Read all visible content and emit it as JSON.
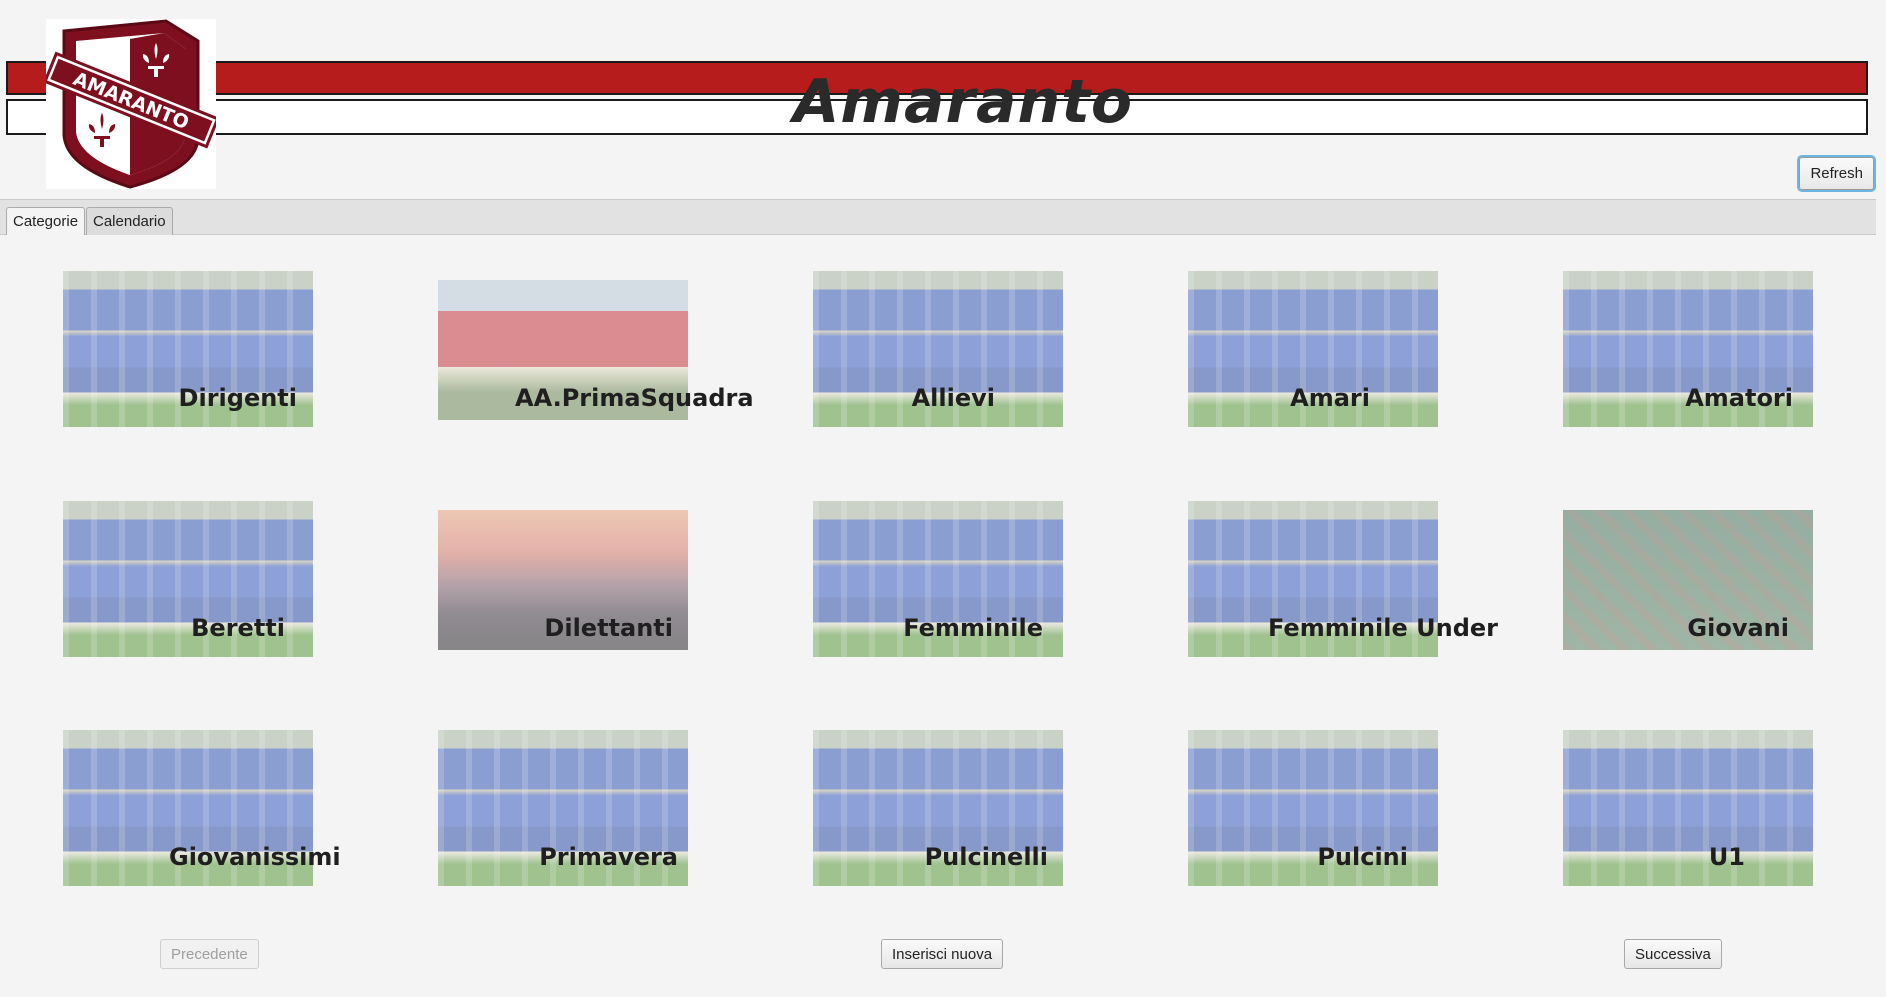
{
  "header": {
    "title": "Amaranto",
    "logo_text": "AMARANTO",
    "brand_color": "#b71c1c"
  },
  "toolbar": {
    "refresh_label": "Refresh"
  },
  "tabs": [
    {
      "label": "Categorie",
      "active": true
    },
    {
      "label": "Calendario",
      "active": false
    }
  ],
  "categories": [
    {
      "label": "Dirigenti",
      "image": "team-photo"
    },
    {
      "label": "AA.PrimaSquadra",
      "image": "red-team-photo"
    },
    {
      "label": "Allievi",
      "image": "team-photo"
    },
    {
      "label": "Amari",
      "image": "team-photo"
    },
    {
      "label": "Amatori",
      "image": "team-photo"
    },
    {
      "label": "Beretti",
      "image": "team-photo"
    },
    {
      "label": "Dilettanti",
      "image": "canal-photo"
    },
    {
      "label": "Femminile",
      "image": "team-photo"
    },
    {
      "label": "Femminile Under",
      "image": "team-photo"
    },
    {
      "label": "Giovani",
      "image": "aerial-photo"
    },
    {
      "label": "Giovanissimi",
      "image": "team-photo"
    },
    {
      "label": "Primavera",
      "image": "team-photo"
    },
    {
      "label": "Pulcinelli",
      "image": "team-photo"
    },
    {
      "label": "Pulcini",
      "image": "team-photo"
    },
    {
      "label": "U1",
      "image": "team-photo"
    }
  ],
  "pagination": {
    "prev_label": "Precedente",
    "new_label": "Inserisci nuova",
    "next_label": "Successiva"
  }
}
